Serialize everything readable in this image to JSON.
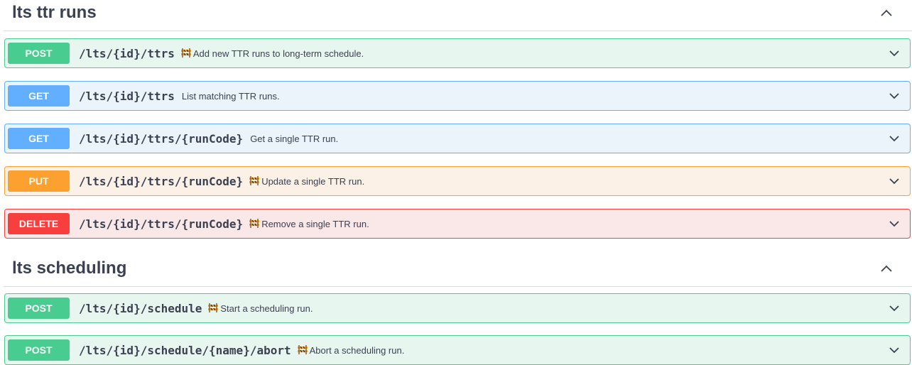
{
  "sections": [
    {
      "title": "lts ttr runs",
      "collapse_icon": "chevron-up-icon",
      "operations": [
        {
          "method": "POST",
          "path": "/lts/{id}/ttrs",
          "wip": true,
          "summary": "Add new TTR runs to long-term schedule."
        },
        {
          "method": "GET",
          "path": "/lts/{id}/ttrs",
          "wip": false,
          "summary": "List matching TTR runs."
        },
        {
          "method": "GET",
          "path": "/lts/{id}/ttrs/{runCode}",
          "wip": false,
          "summary": "Get a single TTR run."
        },
        {
          "method": "PUT",
          "path": "/lts/{id}/ttrs/{runCode}",
          "wip": true,
          "summary": "Update a single TTR run."
        },
        {
          "method": "DELETE",
          "path": "/lts/{id}/ttrs/{runCode}",
          "wip": true,
          "summary": "Remove a single TTR run."
        }
      ]
    },
    {
      "title": "lts scheduling",
      "collapse_icon": "chevron-up-icon",
      "operations": [
        {
          "method": "POST",
          "path": "/lts/{id}/schedule",
          "wip": true,
          "summary": "Start a scheduling run."
        },
        {
          "method": "POST",
          "path": "/lts/{id}/schedule/{name}/abort",
          "wip": true,
          "summary": "Abort a scheduling run."
        }
      ]
    }
  ],
  "icons": {
    "wip": "construction-icon",
    "expand": "chevron-down-icon"
  },
  "colors": {
    "post": "#49cc90",
    "get": "#61affe",
    "put": "#fca130",
    "delete": "#f93e3e"
  }
}
